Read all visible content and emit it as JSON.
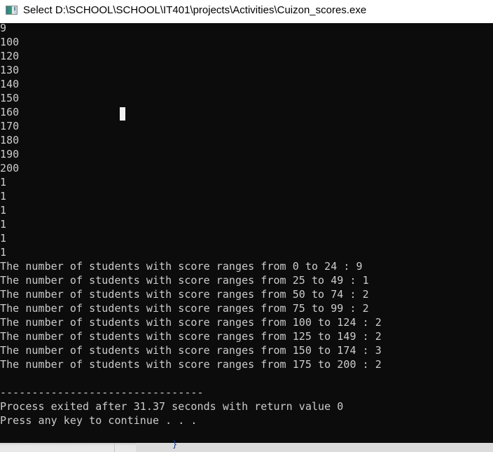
{
  "window": {
    "title": "Select D:\\SCHOOL\\SCHOOL\\IT401\\projects\\Activities\\Cuizon_scores.exe",
    "icon": "console-app-icon"
  },
  "console": {
    "lines": [
      "9",
      "100",
      "120",
      "130",
      "140",
      "150",
      "160",
      "170",
      "180",
      "190",
      "200",
      "1",
      "1",
      "1",
      "1",
      "1",
      "1",
      "The number of students with score ranges from 0 to 24 : 9",
      "The number of students with score ranges from 25 to 49 : 1",
      "The number of students with score ranges from 50 to 74 : 2",
      "The number of students with score ranges from 75 to 99 : 2",
      "The number of students with score ranges from 100 to 124 : 2",
      "The number of students with score ranges from 125 to 149 : 2",
      "The number of students with score ranges from 150 to 174 : 3",
      "The number of students with score ranges from 175 to 200 : 2",
      "",
      "--------------------------------",
      "Process exited after 31.37 seconds with return value 0",
      "Press any key to continue . . ."
    ],
    "text_color": "#cccccc",
    "background_color": "#0c0c0c"
  },
  "background_editor": {
    "visible_glyph": "}"
  }
}
